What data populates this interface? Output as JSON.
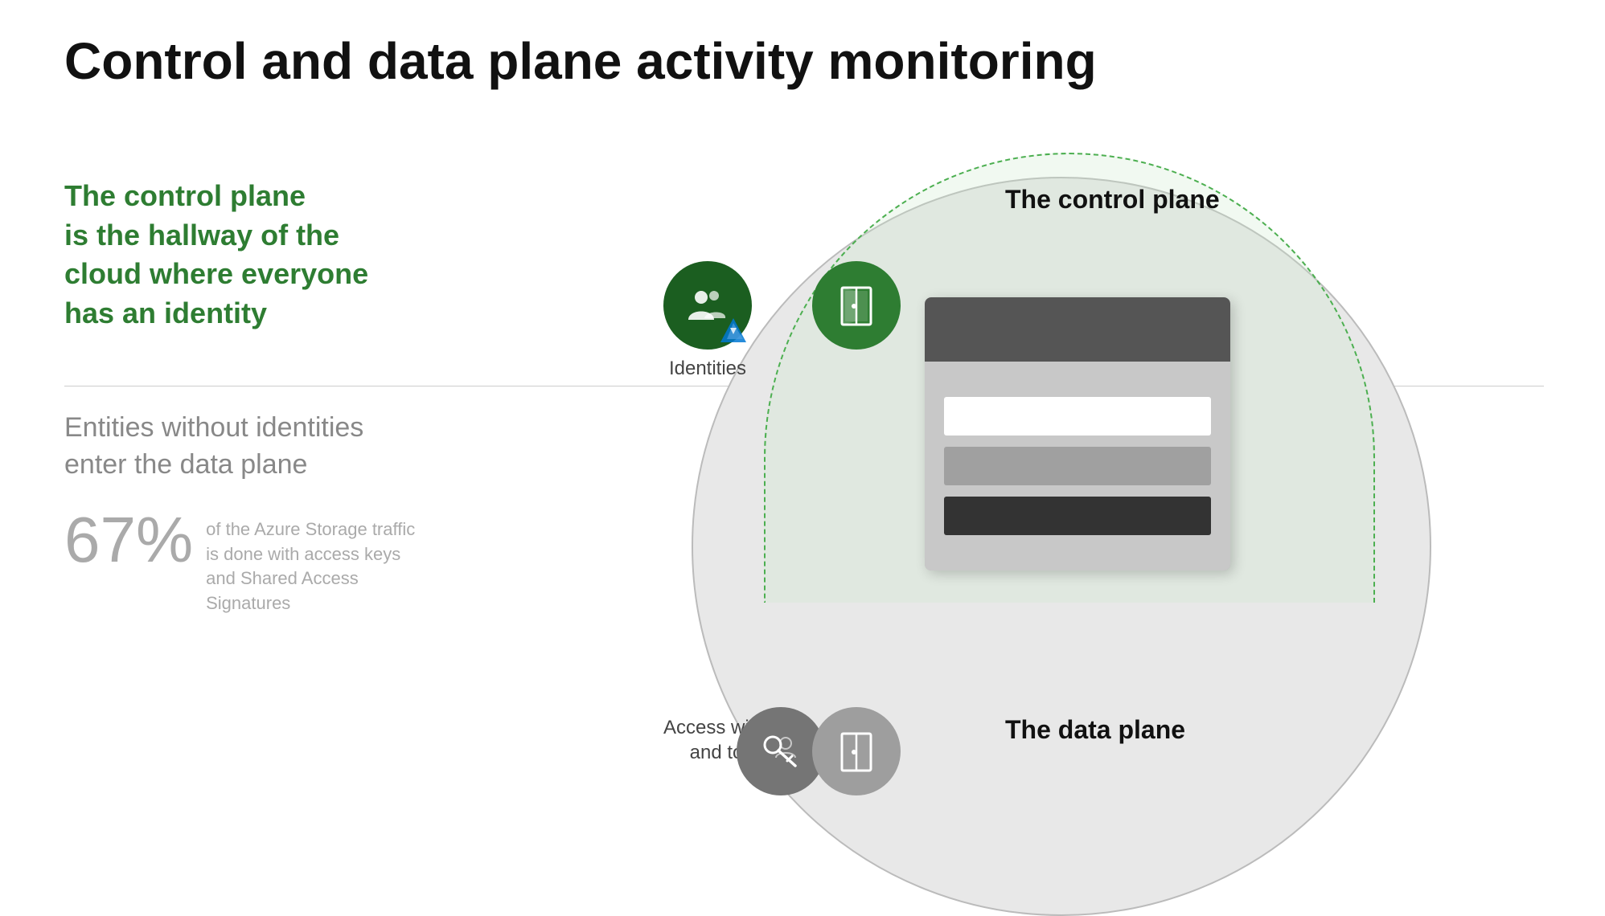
{
  "page": {
    "title": "Control and data plane activity monitoring",
    "background": "#ffffff"
  },
  "left_panel": {
    "control_plane_heading_line1": "The control plane",
    "control_plane_heading_line2": "is the hallway of the",
    "control_plane_heading_line3": "cloud where everyone",
    "control_plane_heading_line4": "has an identity",
    "entities_text_line1": "Entities without identities",
    "entities_text_line2": "enter the data plane",
    "percentage": "67%",
    "percentage_desc": "of the Azure Storage traffic is done with access keys and Shared Access Signatures"
  },
  "diagram": {
    "control_plane_label": "The control plane",
    "data_plane_label": "The data plane",
    "identities_label": "Identities",
    "keys_label": "Access with keys\nand tokens"
  },
  "colors": {
    "green_dark": "#1b5e20",
    "green_medium": "#2e7d32",
    "green_text": "#2e7d32",
    "gray_circle": "#757575",
    "gray_light": "#9e9e9e",
    "percentage_color": "#aaaaaa"
  }
}
